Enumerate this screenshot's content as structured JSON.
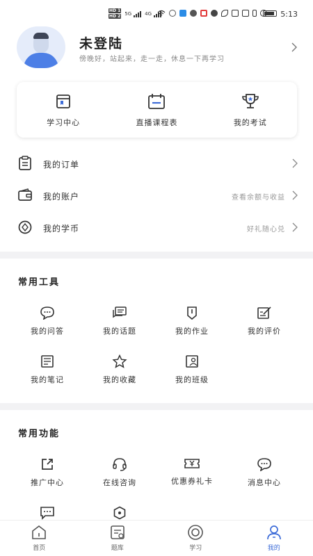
{
  "status_bar": {
    "hd1": "HD 1",
    "hd2": "HD 2",
    "net1": "5G",
    "net2": "4G",
    "time": "5:13"
  },
  "profile": {
    "name": "未登陆",
    "slogan": "傍晚好，站起来，走一走，休息一下再学习"
  },
  "quick_links": [
    {
      "label": "学习中心",
      "icon": "book-icon"
    },
    {
      "label": "直播课程表",
      "icon": "calendar-icon"
    },
    {
      "label": "我的考试",
      "icon": "trophy-icon"
    }
  ],
  "account_rows": [
    {
      "label": "我的订单",
      "hint": "",
      "icon": "clipboard-icon"
    },
    {
      "label": "我的账户",
      "hint": "查看余额与收益",
      "icon": "wallet-icon"
    },
    {
      "label": "我的学币",
      "hint": "好礼随心兑",
      "icon": "coin-icon"
    }
  ],
  "tools": {
    "title": "常用工具",
    "items": [
      {
        "label": "我的问答",
        "icon": "chat-bubble-icon"
      },
      {
        "label": "我的话题",
        "icon": "topic-icon"
      },
      {
        "label": "我的作业",
        "icon": "homework-icon"
      },
      {
        "label": "我的评价",
        "icon": "review-icon"
      },
      {
        "label": "我的笔记",
        "icon": "notes-icon"
      },
      {
        "label": "我的收藏",
        "icon": "star-icon"
      },
      {
        "label": "我的班级",
        "icon": "class-icon"
      }
    ]
  },
  "functions": {
    "title": "常用功能",
    "items": [
      {
        "label": "推广中心",
        "icon": "share-icon"
      },
      {
        "label": "在线咨询",
        "icon": "headset-icon"
      },
      {
        "label": "优惠券礼卡",
        "icon": "coupon-icon"
      },
      {
        "label": "消息中心",
        "icon": "message-icon"
      },
      {
        "label": "",
        "icon": "feedback-icon"
      },
      {
        "label": "",
        "icon": "settings-icon"
      }
    ]
  },
  "tabbar": {
    "items": [
      {
        "label": "首页",
        "icon": "home-icon",
        "active": false
      },
      {
        "label": "题库",
        "icon": "question-bank-icon",
        "active": false
      },
      {
        "label": "学习",
        "icon": "study-icon",
        "active": false
      },
      {
        "label": "我的",
        "icon": "user-icon",
        "active": true
      }
    ]
  },
  "colors": {
    "accent": "#3d6cd8",
    "text": "#222222",
    "muted": "#999999",
    "divider": "#f2f2f4"
  }
}
